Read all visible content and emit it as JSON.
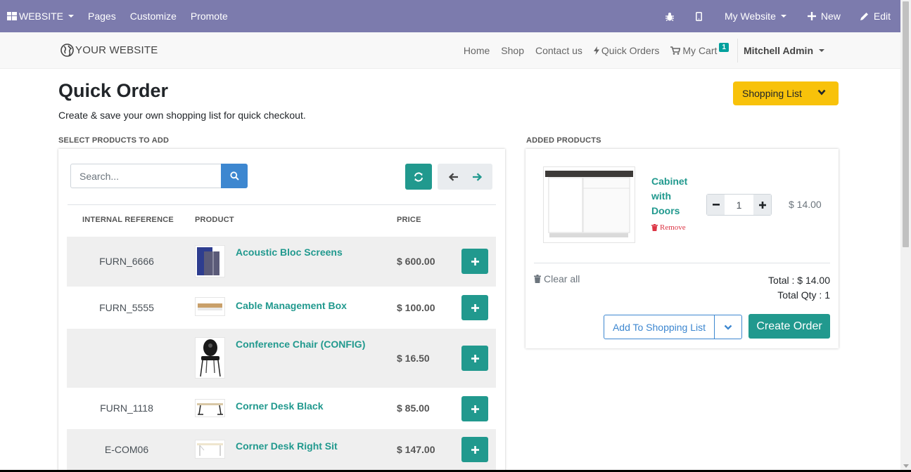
{
  "adminbar": {
    "website_menu": "WEBSITE",
    "pages": "Pages",
    "customize": "Customize",
    "promote": "Promote",
    "my_website": "My Website",
    "new": "New",
    "edit": "Edit"
  },
  "header": {
    "logo_text": "YOUR WEBSITE",
    "nav": [
      "Home",
      "Shop",
      "Contact us",
      "Quick Orders"
    ],
    "cart_label": "My Cart",
    "cart_count": "1",
    "user": "Mitchell Admin"
  },
  "page": {
    "title": "Quick Order",
    "subtitle": "Create & save your own shopping list for quick checkout.",
    "shopping_list_button": "Shopping List",
    "select_label": "SELECT PRODUCTS TO ADD",
    "added_label": "ADDED PRODUCTS"
  },
  "search": {
    "placeholder": "Search..."
  },
  "table": {
    "headers": [
      "INTERNAL REFERENCE",
      "PRODUCT",
      "PRICE"
    ],
    "rows": [
      {
        "ref": "FURN_6666",
        "name": "Acoustic Bloc Screens",
        "price": "$ 600.00"
      },
      {
        "ref": "FURN_5555",
        "name": "Cable Management Box",
        "price": "$ 100.00"
      },
      {
        "ref": "",
        "name": "Conference Chair (CONFIG)",
        "price": "$ 16.50"
      },
      {
        "ref": "FURN_1118",
        "name": "Corner Desk Black",
        "price": "$ 85.00"
      },
      {
        "ref": "E-COM06",
        "name": "Corner Desk Right Sit",
        "price": "$ 147.00"
      }
    ]
  },
  "cart": {
    "item_name": "Cabinet with Doors",
    "remove": "Remove",
    "quantity": "1",
    "item_price": "$ 14.00",
    "clear_all": "Clear all",
    "total": "Total : $ 14.00",
    "total_qty": "Total Qty : 1",
    "add_to_shopping_list": "Add To Shopping List",
    "create_order": "Create Order"
  },
  "colors": {
    "admin_bar": "#7c7bad",
    "accent_teal": "#21998e",
    "primary_blue": "#3d87d0",
    "warning_yellow": "#f8c20a"
  }
}
